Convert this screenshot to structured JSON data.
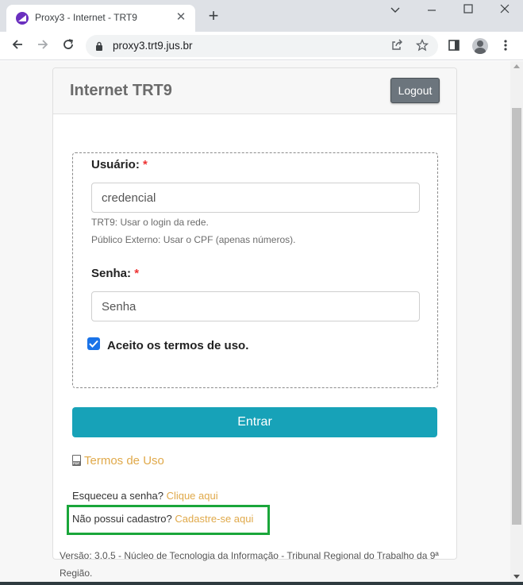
{
  "browser": {
    "tab_title": "Proxy3 - Internet - TRT9",
    "url": "proxy3.trt9.jus.br",
    "new_tab_symbol": "+",
    "close_symbol": "✕"
  },
  "page": {
    "card_title": "Internet TRT9",
    "logout_label": "Logout",
    "user_label": "Usuário:",
    "user_required": "*",
    "user_placeholder": "credencial",
    "help_line_1": "TRT9: Usar o login da rede.",
    "help_line_2": "Público Externo: Usar o CPF (apenas números).",
    "password_label": "Senha:",
    "password_required": "*",
    "password_placeholder": "Senha",
    "terms_checkbox_label": "Aceito os termos de uso.",
    "terms_checked": true,
    "submit_label": "Entrar",
    "terms_link": "Termos de Uso",
    "forgot_text": "Esqueceu a senha?",
    "forgot_link": "Clique aqui",
    "register_text": "Não possui cadastro?",
    "register_link": "Cadastre-se aqui",
    "footer_line_1": "Versão: 3.0.5 - Núcleo de Tecnologia da Informação - Tribunal Regional do Trabalho da 9ª",
    "footer_line_2": "Região."
  },
  "colors": {
    "primary_button": "#17a2b8",
    "link": "#e0a94a",
    "highlight": "#1aa63a",
    "logout_button": "#6c757d"
  }
}
